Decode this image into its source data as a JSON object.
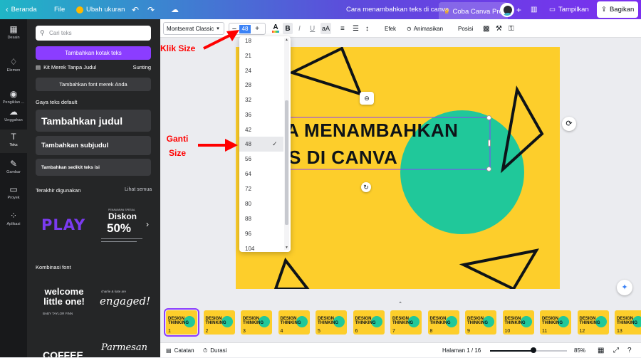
{
  "topbar": {
    "home": "Beranda",
    "file": "File",
    "resize": "Ubah ukuran",
    "doc_title": "Cara menambahkan teks di canva",
    "pro": "Coba Canva Pro",
    "present": "Tampilkan",
    "share": "Bagikan"
  },
  "rail": [
    {
      "label": "Desain",
      "icon": "layout-icon",
      "glyph": "▦"
    },
    {
      "label": "Elemen",
      "icon": "shapes-icon",
      "glyph": "♢"
    },
    {
      "label": "Pengiklan ...",
      "icon": "brand-icon",
      "glyph": "◉"
    },
    {
      "label": "Unggahan",
      "icon": "cloud-upload-icon",
      "glyph": "☁"
    },
    {
      "label": "Teks",
      "icon": "text-icon",
      "glyph": "T"
    },
    {
      "label": "Gambar",
      "icon": "draw-icon",
      "glyph": "✎"
    },
    {
      "label": "Proyek",
      "icon": "folder-icon",
      "glyph": "▭"
    },
    {
      "label": "Aplikasi",
      "icon": "apps-icon",
      "glyph": "⁘"
    }
  ],
  "panel": {
    "search_placeholder": "Cari teks",
    "add_textbox": "Tambahkan kotak teks",
    "brand_kit": "Kit Merek Tanpa Judul",
    "edit": "Sunting",
    "add_brand_font": "Tambahkan font merek Anda",
    "default_styles": "Gaya teks default",
    "add_heading": "Tambahkan judul",
    "add_subheading": "Tambahkan subjudul",
    "add_body": "Tambahkan sedikit teks isi",
    "recent": "Terakhir digunakan",
    "see_all": "Lihat semua",
    "recent_thumbs": {
      "play": "PLAY",
      "diskon_small": "PENAWARAN SPESIAL",
      "diskon": "Diskon",
      "diskon_pct": "50%"
    },
    "combos": "Kombinasi font",
    "combo_thumbs": {
      "welcome": "welcome little one!",
      "welcome_sub": "BABY TAYLOR FINN",
      "engaged_small": "charlie & kate are",
      "engaged": "engaged!",
      "coffee": "COFFEE",
      "parmesan": "Parmesan"
    }
  },
  "toolbar": {
    "font": "Montserrat Classic",
    "size_value": "48",
    "effects": "Efek",
    "animate": "Animasikan",
    "position": "Posisi"
  },
  "canvas": {
    "line1": "A MENAMBAHKAN",
    "line2": "S DI CANVA"
  },
  "dropdown": {
    "sizes": [
      "18",
      "21",
      "24",
      "28",
      "32",
      "36",
      "42",
      "48",
      "56",
      "64",
      "72",
      "80",
      "88",
      "96",
      "104"
    ],
    "selected": "48"
  },
  "annotations": {
    "click_size": "Klik Size",
    "change_size": "Ganti Size"
  },
  "filmstrip": {
    "thumb_text": "DESIGN THINKING",
    "pages": [
      "1",
      "2",
      "3",
      "4",
      "5",
      "6",
      "7",
      "8",
      "9",
      "10",
      "11",
      "12",
      "13"
    ]
  },
  "bottombar": {
    "notes": "Catatan",
    "duration": "Durasi",
    "page": "Halaman 1 / 16",
    "zoom": "85%",
    "zoom_level": 0.85
  },
  "colors": {
    "canvas_bg": "#fdce2b",
    "circle": "#20c89a",
    "accent": "#8b3dff",
    "annotation": "#ff0000"
  }
}
